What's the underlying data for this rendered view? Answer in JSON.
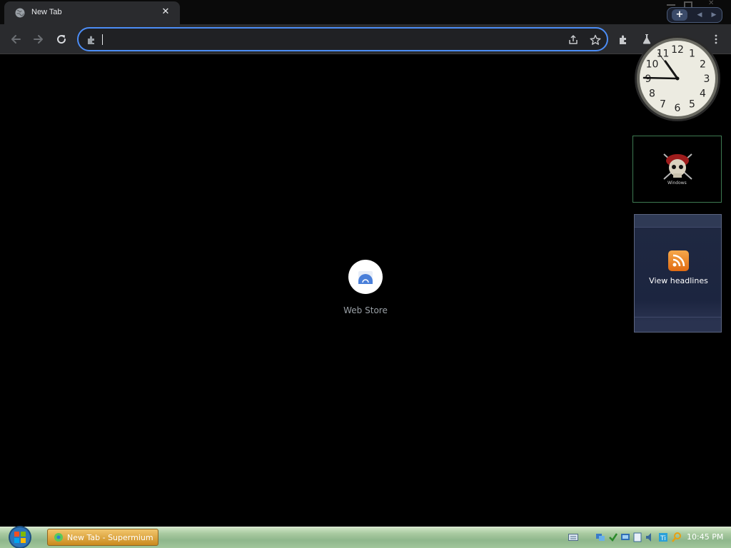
{
  "browser": {
    "tab": {
      "title": "New Tab",
      "close_glyph": "✕",
      "favicon": "globe-icon"
    },
    "tab_widget": {
      "plus_label": "+",
      "prev_label": "◀",
      "next_label": "▶"
    },
    "omnibox": {
      "value": "",
      "site_icon": "puzzle-icon"
    },
    "toolbar_icons": [
      "back-icon",
      "forward-icon",
      "reload-icon",
      "share-icon",
      "star-icon",
      "extensions-icon",
      "labs-icon",
      "profile-icon",
      "menu-icon"
    ]
  },
  "page": {
    "shortcut": {
      "label": "Web Store",
      "icon": "web-store-icon"
    }
  },
  "gadgets": {
    "clock": {
      "numerals": [
        "12",
        "1",
        "2",
        "3",
        "4",
        "5",
        "6",
        "7",
        "8",
        "9",
        "10",
        "11"
      ],
      "time": "10:45"
    },
    "photo": {
      "caption": "Windows"
    },
    "feed": {
      "label": "View headlines"
    }
  },
  "taskbar": {
    "task_label": "New Tab - Supermium",
    "clock": "10:45 PM"
  },
  "colors": {
    "accent": "#4c8df6",
    "chrome": "#2a2b2e",
    "taskbar": "#a8c9a0"
  }
}
